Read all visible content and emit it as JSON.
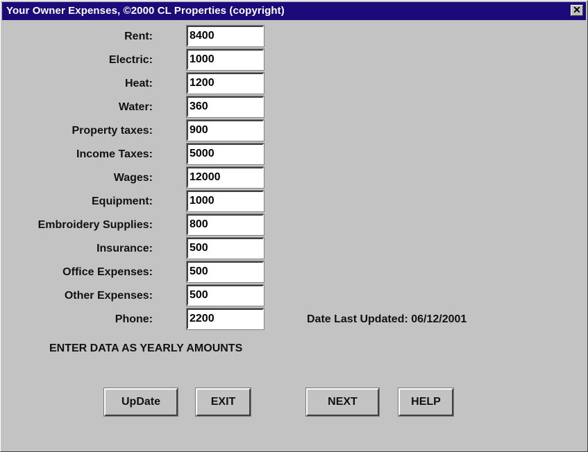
{
  "window": {
    "title": "Your Owner Expenses, ©2000 CL Properties (copyright)",
    "close_glyph": "✕",
    "close_icon": "close-icon"
  },
  "fields": [
    {
      "label": "Rent:",
      "value": "8400"
    },
    {
      "label": "Electric:",
      "value": "1000"
    },
    {
      "label": "Heat:",
      "value": "1200"
    },
    {
      "label": "Water:",
      "value": "360"
    },
    {
      "label": "Property taxes:",
      "value": "900"
    },
    {
      "label": "Income Taxes:",
      "value": "5000"
    },
    {
      "label": "Wages:",
      "value": "12000"
    },
    {
      "label": "Equipment:",
      "value": "1000"
    },
    {
      "label": "Embroidery Supplies:",
      "value": "800"
    },
    {
      "label": "Insurance:",
      "value": "500"
    },
    {
      "label": "Office Expenses:",
      "value": "500"
    },
    {
      "label": "Other Expenses:",
      "value": "500"
    },
    {
      "label": "Phone:",
      "value": "2200"
    }
  ],
  "date_updated": "Date Last Updated:  06/12/2001",
  "instruction": "ENTER DATA AS YEARLY AMOUNTS",
  "buttons": {
    "update": "UpDate",
    "exit": "EXIT",
    "next": "NEXT",
    "help": "HELP"
  },
  "colors": {
    "titlebar": "#1c0a7a",
    "window_bg": "#c3c3c3",
    "field_bg": "#ffffff"
  }
}
